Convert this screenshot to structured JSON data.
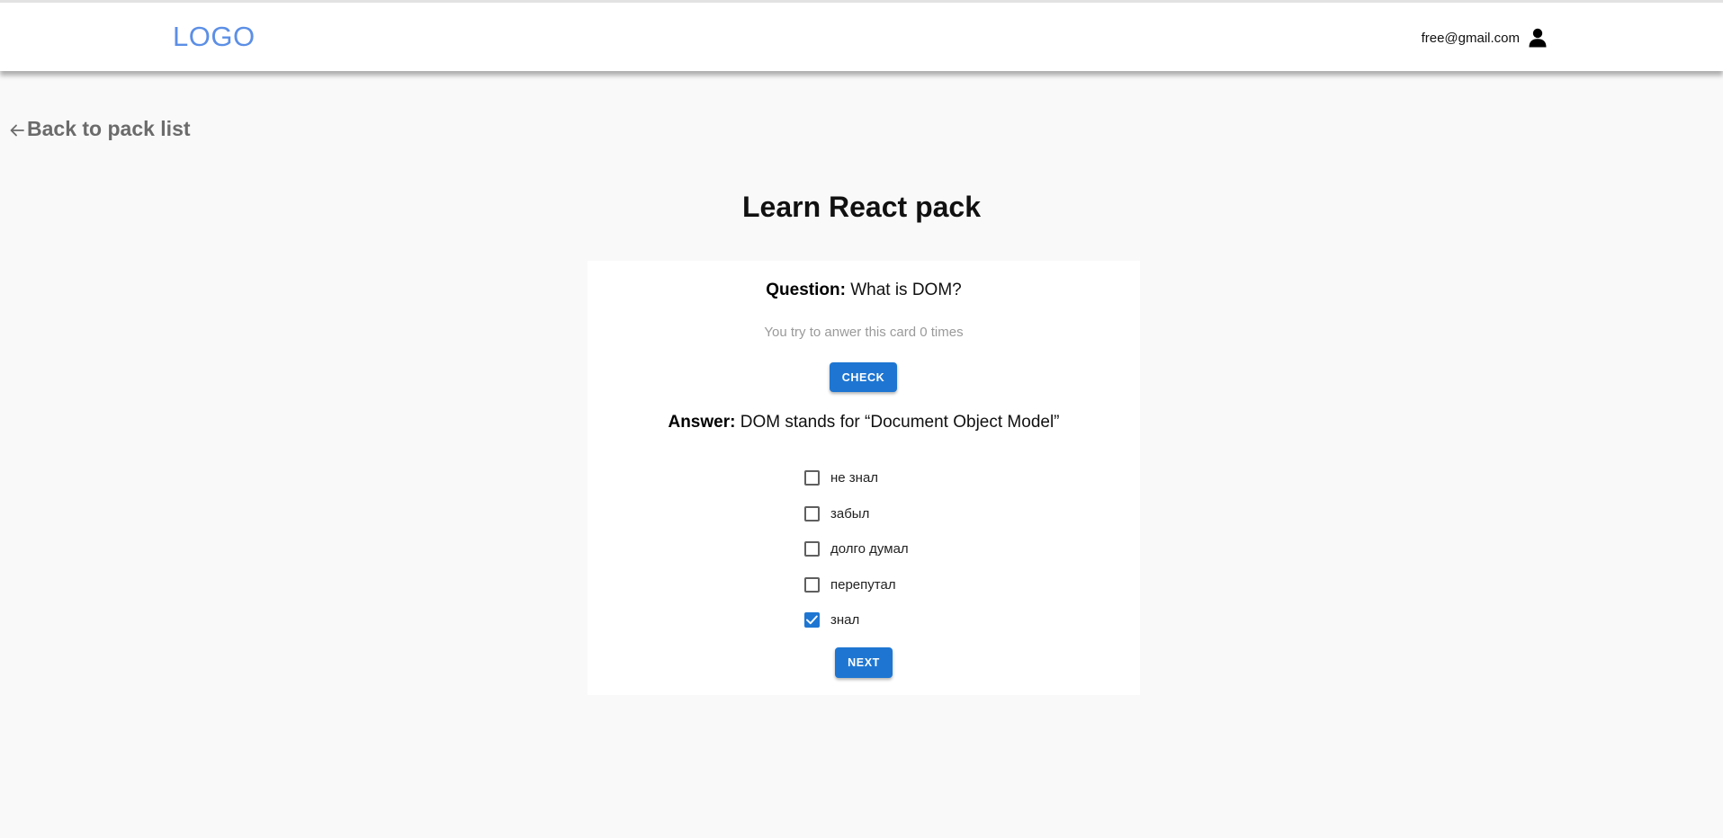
{
  "header": {
    "logo": "LOGO",
    "user_email": "free@gmail.com",
    "user_icon": "user-icon"
  },
  "nav": {
    "back_label": "Back to pack list",
    "back_icon": "arrow-left-icon"
  },
  "page": {
    "title": "Learn React pack"
  },
  "card": {
    "question_label": "Question:",
    "question_text": "What is DOM?",
    "attempts_text": "You try to anwer this card 0 times",
    "check_label": "CHECK",
    "answer_label": "Answer:",
    "answer_text": "DOM stands for “Document Object Model”",
    "options": [
      {
        "label": "не знал",
        "checked": false
      },
      {
        "label": "забыл",
        "checked": false
      },
      {
        "label": "долго думал",
        "checked": false
      },
      {
        "label": "перепутал",
        "checked": false
      },
      {
        "label": "знал",
        "checked": true
      }
    ],
    "next_label": "NEXT"
  },
  "colors": {
    "accent": "#1e76d2",
    "logo": "#5c8fe6",
    "background": "#f9f9f9"
  }
}
